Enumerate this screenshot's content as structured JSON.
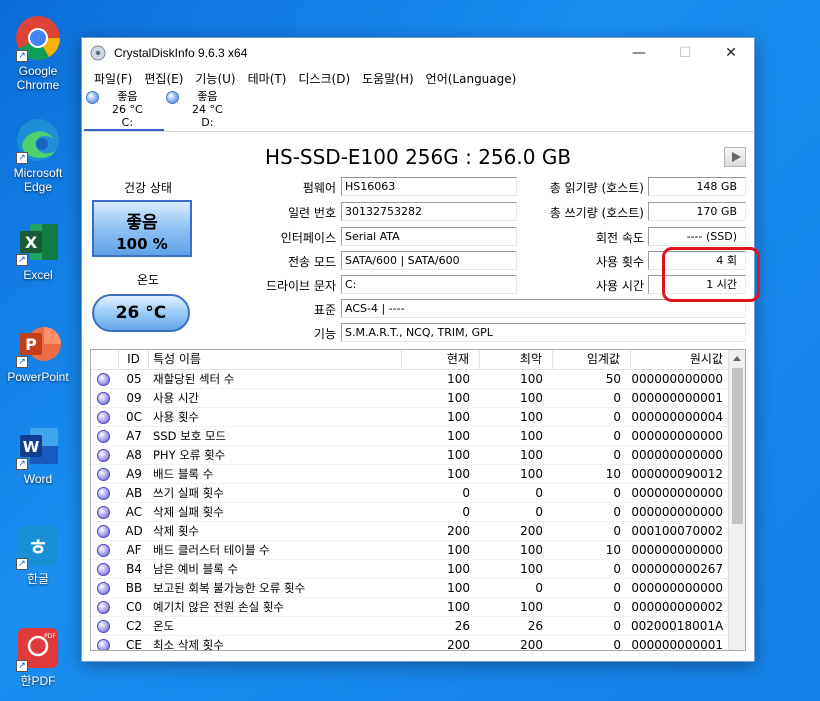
{
  "desktop": {
    "icons": [
      {
        "label": "Google\nChrome",
        "icon": "chrome-icon"
      },
      {
        "label": "Microsoft\nEdge",
        "icon": "edge-icon"
      },
      {
        "label": "Excel",
        "icon": "excel-icon"
      },
      {
        "label": "PowerPoint",
        "icon": "powerpoint-icon"
      },
      {
        "label": "Word",
        "icon": "word-icon"
      },
      {
        "label": "한글",
        "icon": "hangul-icon"
      },
      {
        "label": "한PDF",
        "icon": "hanpdf-icon"
      }
    ]
  },
  "window": {
    "title": "CrystalDiskInfo 9.6.3 x64",
    "minimize": "—",
    "maximize": "☐",
    "close": "✕"
  },
  "menu": [
    "파일(F)",
    "편집(E)",
    "기능(U)",
    "테마(T)",
    "디스크(D)",
    "도움말(H)",
    "언어(Language)"
  ],
  "drives": [
    {
      "status": "좋음",
      "temp": "26 °C",
      "letter": "C:"
    },
    {
      "status": "좋음",
      "temp": "24 °C",
      "letter": "D:"
    }
  ],
  "disk": {
    "model": "HS-SSD-E100 256G : 256.0 GB",
    "health_label": "건강 상태",
    "health_status": "좋음",
    "health_percent": "100 %",
    "temp_label": "온도",
    "temp_value": "26 °C",
    "firmware_label": "펌웨어",
    "firmware": "HS16063",
    "serial_label": "일련 번호",
    "serial": "30132753282",
    "interface_label": "인터페이스",
    "interface": "Serial ATA",
    "transfer_label": "전송 모드",
    "transfer": "SATA/600 | SATA/600",
    "drive_letter_label": "드라이브 문자",
    "drive_letter": "C:",
    "standard_label": "표준",
    "standard": "ACS-4 | ----",
    "features_label": "기능",
    "features": "S.M.A.R.T., NCQ, TRIM, GPL",
    "host_reads_label": "총 읽기량 (호스트)",
    "host_reads": "148 GB",
    "host_writes_label": "총 쓰기량 (호스트)",
    "host_writes": "170 GB",
    "rotation_label": "회전 속도",
    "rotation": "---- (SSD)",
    "power_count_label": "사용 횟수",
    "power_count": "4 회",
    "power_hours_label": "사용 시간",
    "power_hours": "1 시간"
  },
  "smart": {
    "headers": {
      "id": "ID",
      "name": "특성 이름",
      "current": "현재",
      "worst": "최악",
      "threshold": "임계값",
      "raw": "원시값"
    },
    "rows": [
      {
        "id": "05",
        "name": "재할당된 섹터 수",
        "current": "100",
        "worst": "100",
        "threshold": "50",
        "raw": "000000000000"
      },
      {
        "id": "09",
        "name": "사용 시간",
        "current": "100",
        "worst": "100",
        "threshold": "0",
        "raw": "000000000001"
      },
      {
        "id": "0C",
        "name": "사용 횟수",
        "current": "100",
        "worst": "100",
        "threshold": "0",
        "raw": "000000000004"
      },
      {
        "id": "A7",
        "name": "SSD 보호 모드",
        "current": "100",
        "worst": "100",
        "threshold": "0",
        "raw": "000000000000"
      },
      {
        "id": "A8",
        "name": "PHY 오류 횟수",
        "current": "100",
        "worst": "100",
        "threshold": "0",
        "raw": "000000000000"
      },
      {
        "id": "A9",
        "name": "배드 블록 수",
        "current": "100",
        "worst": "100",
        "threshold": "10",
        "raw": "000000090012"
      },
      {
        "id": "AB",
        "name": "쓰기 실패 횟수",
        "current": "0",
        "worst": "0",
        "threshold": "0",
        "raw": "000000000000"
      },
      {
        "id": "AC",
        "name": "삭제 실패 횟수",
        "current": "0",
        "worst": "0",
        "threshold": "0",
        "raw": "000000000000"
      },
      {
        "id": "AD",
        "name": "삭제 횟수",
        "current": "200",
        "worst": "200",
        "threshold": "0",
        "raw": "000100070002"
      },
      {
        "id": "AF",
        "name": "배드 클러스터 테이블 수",
        "current": "100",
        "worst": "100",
        "threshold": "10",
        "raw": "000000000000"
      },
      {
        "id": "B4",
        "name": "남은 예비 블록 수",
        "current": "100",
        "worst": "100",
        "threshold": "0",
        "raw": "000000000267"
      },
      {
        "id": "BB",
        "name": "보고된 회복 불가능한 오류 횟수",
        "current": "100",
        "worst": "0",
        "threshold": "0",
        "raw": "000000000000"
      },
      {
        "id": "C0",
        "name": "예기치 않은 전원 손실 횟수",
        "current": "100",
        "worst": "100",
        "threshold": "0",
        "raw": "000000000002"
      },
      {
        "id": "C2",
        "name": "온도",
        "current": "26",
        "worst": "26",
        "threshold": "0",
        "raw": "00200018001A"
      },
      {
        "id": "CE",
        "name": "최소 삭제 횟수",
        "current": "200",
        "worst": "200",
        "threshold": "0",
        "raw": "000000000001"
      }
    ]
  }
}
